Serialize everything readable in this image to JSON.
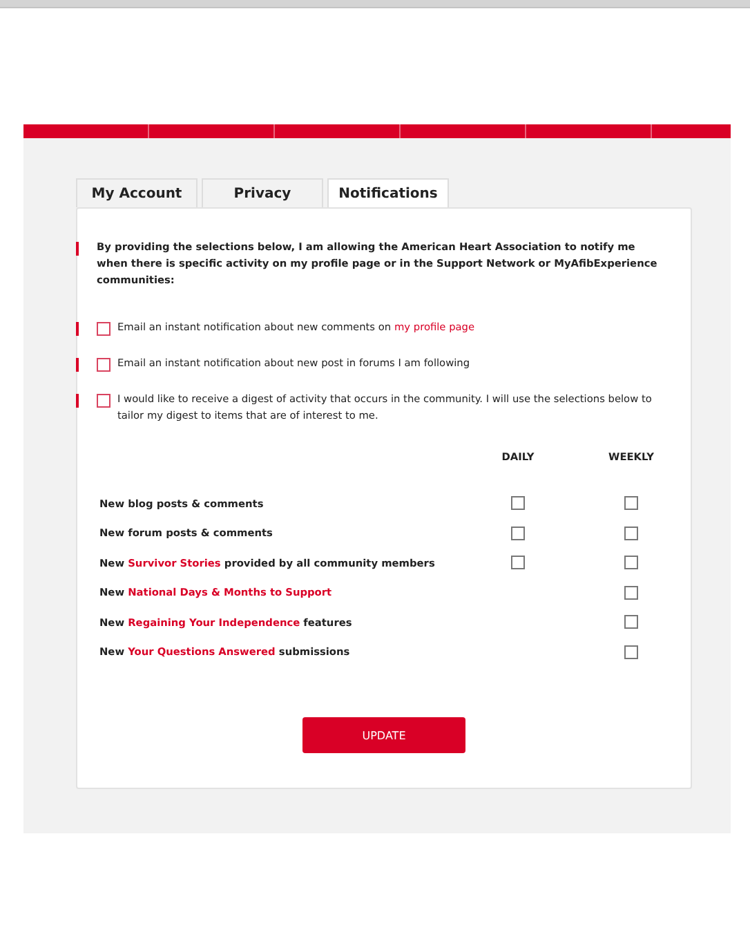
{
  "tabs": [
    {
      "label": "My Account",
      "selected": false
    },
    {
      "label": "Privacy",
      "selected": false
    },
    {
      "label": "Notifications",
      "selected": true
    }
  ],
  "intro": "By providing the selections below, I am allowing the American Heart Association to notify me when there is specific activity on my profile page or in the Support Network or MyAfibExperience communities:",
  "options": [
    {
      "text": "Email an instant notification about new comments on ",
      "link": "my profile page",
      "checked": false
    },
    {
      "text": "Email an instant notification about new post in forums I am following",
      "checked": false
    },
    {
      "text": "I would like to receive a digest of activity that occurs in the community. I will use the selections below to tailor my digest to items that are of interest to me.",
      "checked": false
    }
  ],
  "columns": [
    "DAILY",
    "WEEKLY"
  ],
  "rows": [
    {
      "before": "New blog posts & comments",
      "daily": {
        "checked": false
      },
      "weekly": {
        "checked": false
      }
    },
    {
      "before": "New forum posts & comments",
      "daily": {
        "checked": false
      },
      "weekly": {
        "checked": false
      }
    },
    {
      "before": "New ",
      "link": "Survivor Stories",
      "after": " provided by all community members",
      "daily": {
        "checked": false
      },
      "weekly": {
        "checked": false
      }
    },
    {
      "before": "New ",
      "link": "National Days & Months to Support",
      "weekly": {
        "checked": false
      }
    },
    {
      "before": "New ",
      "link": "Regaining Your Independence",
      "after": " features",
      "weekly": {
        "checked": false
      }
    },
    {
      "before": "New ",
      "link": "Your Questions Answered",
      "after": " submissions",
      "weekly": {
        "checked": false
      }
    }
  ],
  "button": "UPDATE"
}
